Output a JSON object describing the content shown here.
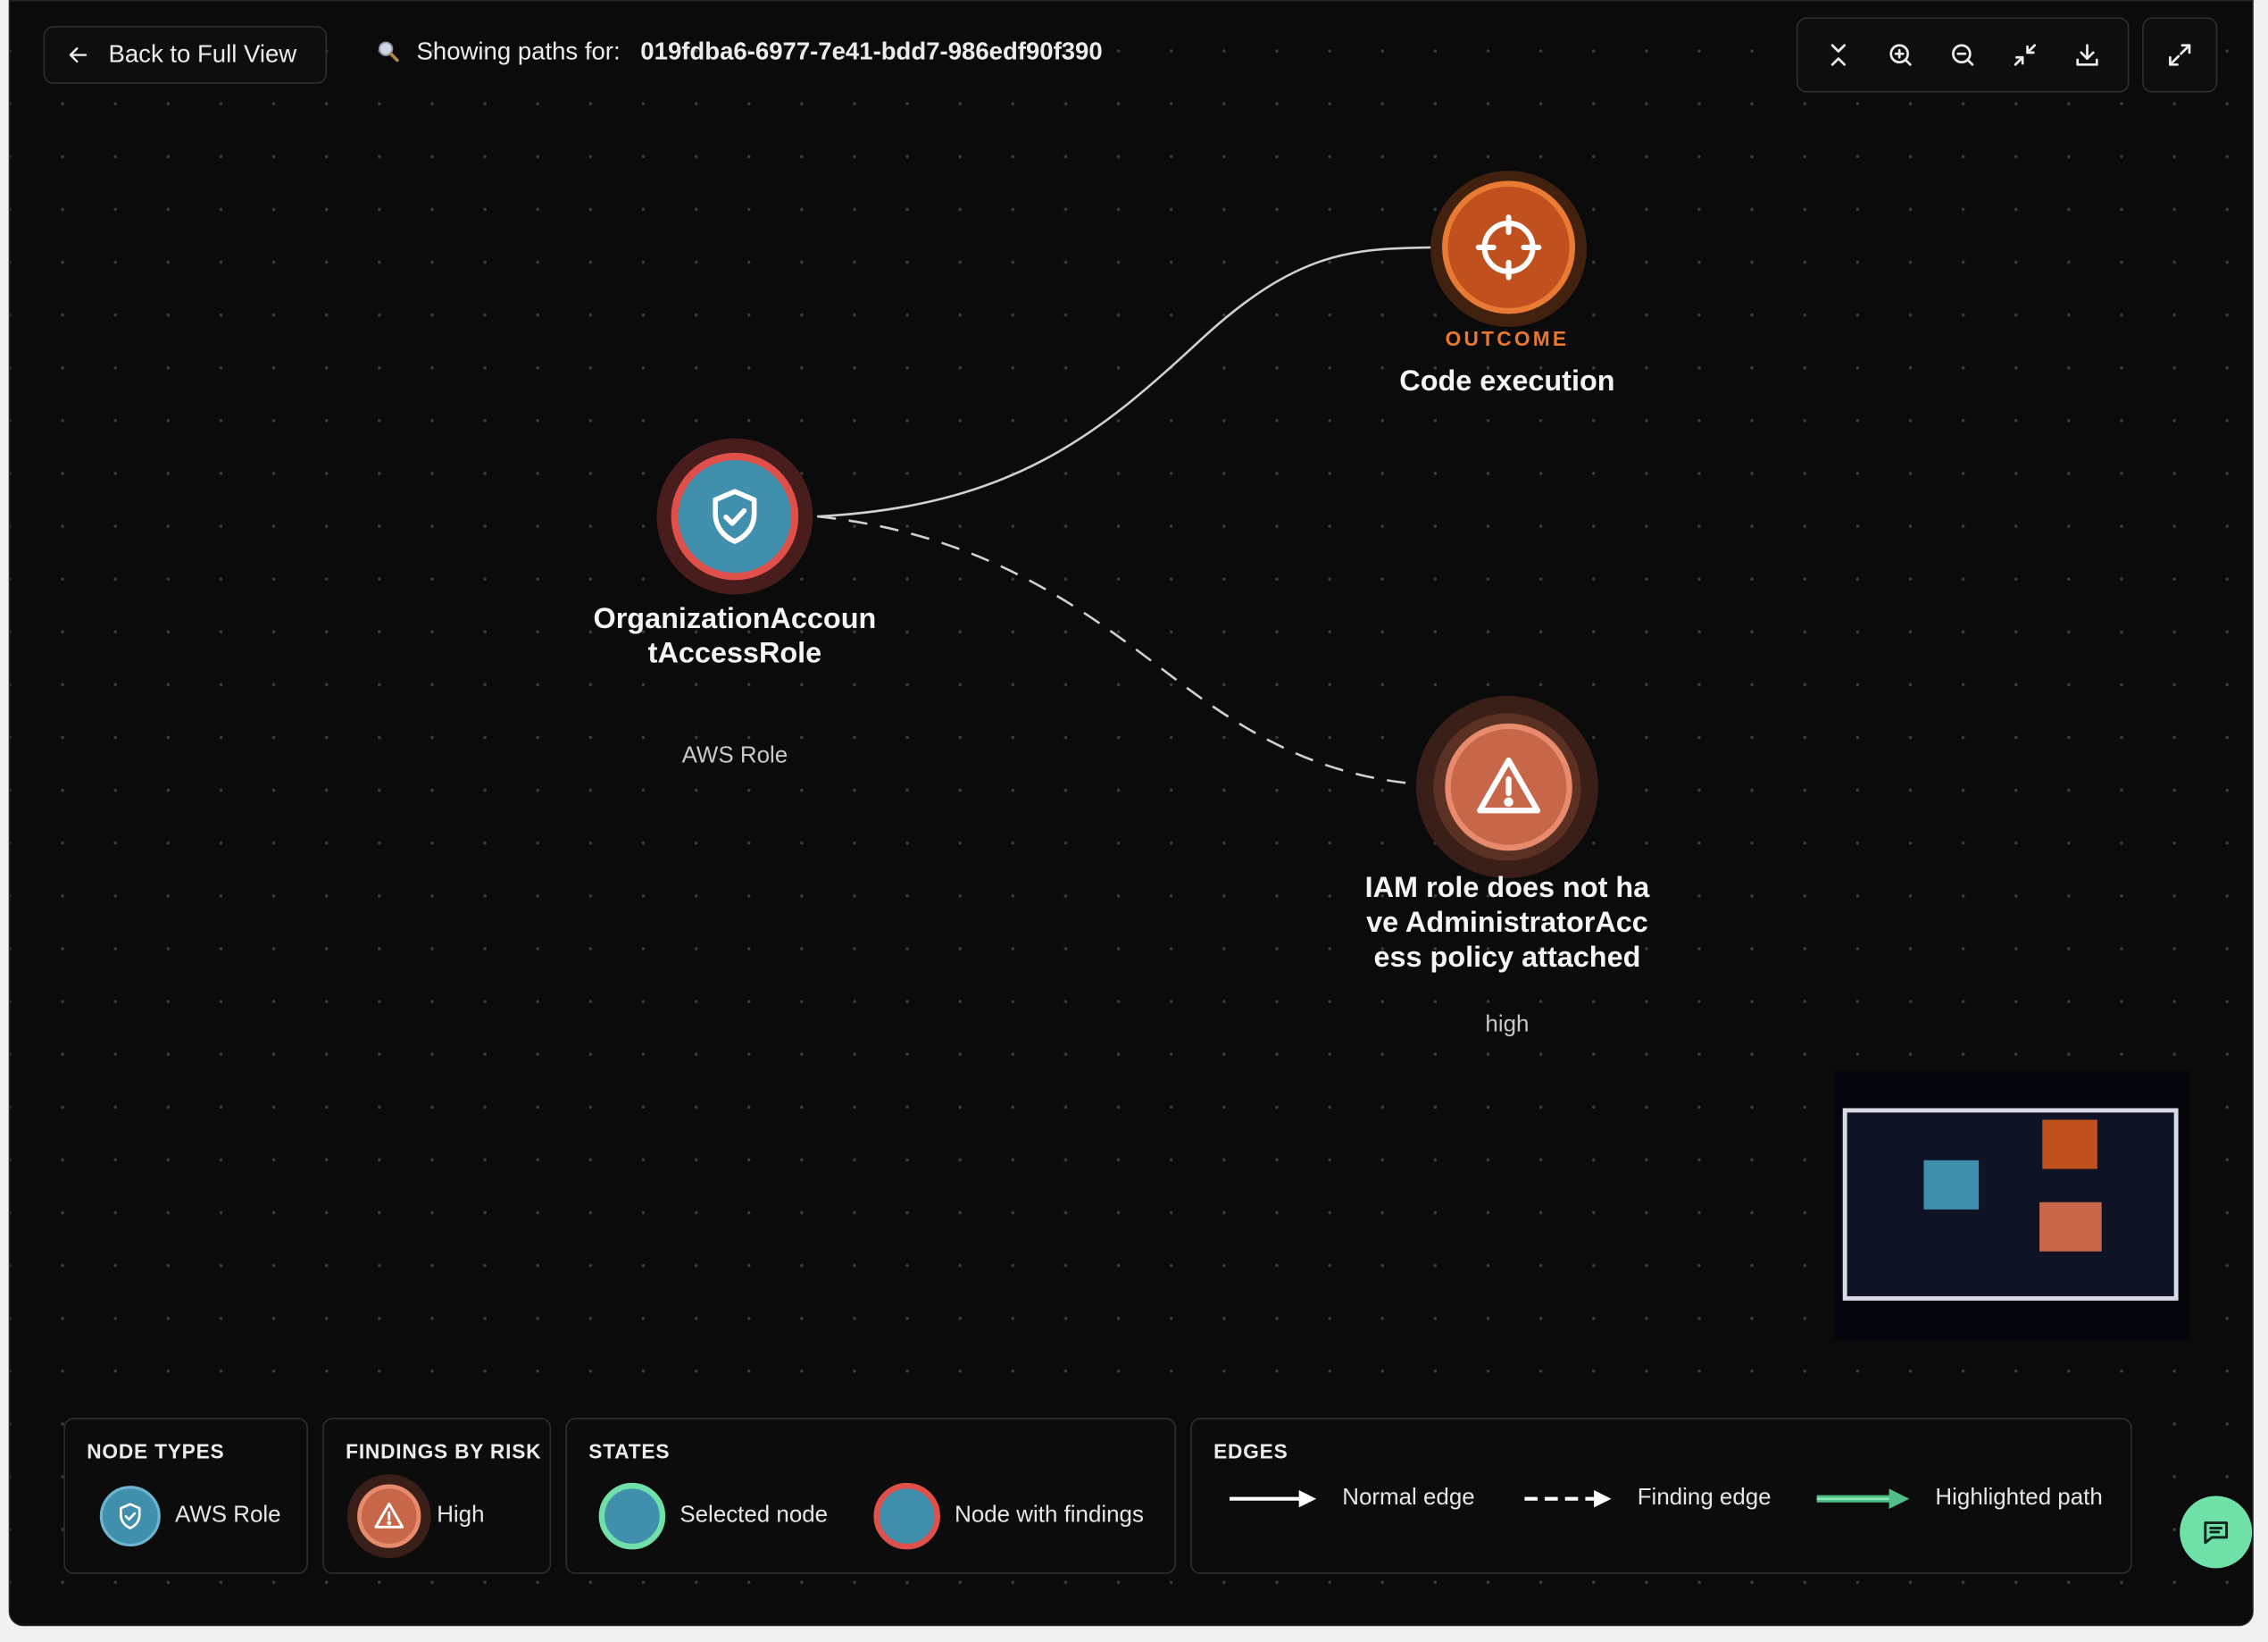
{
  "header": {
    "back_label": "Back to Full View",
    "search_prefix": "Showing paths for:",
    "path_id": "019fdba6-6977-7e41-bdd7-986edf90f390"
  },
  "toolbar": {
    "icons": [
      "collapse-vertical-icon",
      "zoom-in-icon",
      "zoom-out-icon",
      "minimize-icon",
      "download-icon",
      "fullscreen-icon"
    ]
  },
  "graph": {
    "role_node": {
      "title": "OrganizationAccountAccessRole",
      "subtitle": "AWS Role",
      "color": "#3f8fad",
      "ring_color": "#e0504a"
    },
    "outcome_node": {
      "kind": "OUTCOME",
      "title": "Code execution",
      "color": "#c1501f"
    },
    "finding_node": {
      "title": "IAM role does not have AdministratorAccess policy attached",
      "severity": "high",
      "color": "#c8664a"
    }
  },
  "legend": {
    "node_types": {
      "title": "NODE TYPES",
      "items": [
        {
          "label": "AWS Role",
          "icon": "shield-check-icon",
          "color": "#3f8fad"
        }
      ]
    },
    "findings_by_risk": {
      "title": "FINDINGS BY RISK",
      "items": [
        {
          "label": "High",
          "icon": "warning-icon",
          "color": "#c8664a"
        }
      ]
    },
    "states": {
      "title": "STATES",
      "items": [
        {
          "label": "Selected node",
          "ring_color": "#6fe0a8"
        },
        {
          "label": "Node with findings",
          "ring_color": "#e0504a"
        }
      ]
    },
    "edges": {
      "title": "EDGES",
      "items": [
        {
          "label": "Normal edge",
          "style": "solid"
        },
        {
          "label": "Finding edge",
          "style": "dashed"
        },
        {
          "label": "Highlighted path",
          "style": "highlighted",
          "color": "#4fbf87"
        }
      ]
    }
  },
  "colors": {
    "background": "#0b0b0b",
    "accent_green": "#6fe0a8",
    "outcome_orange": "#e8772f"
  }
}
